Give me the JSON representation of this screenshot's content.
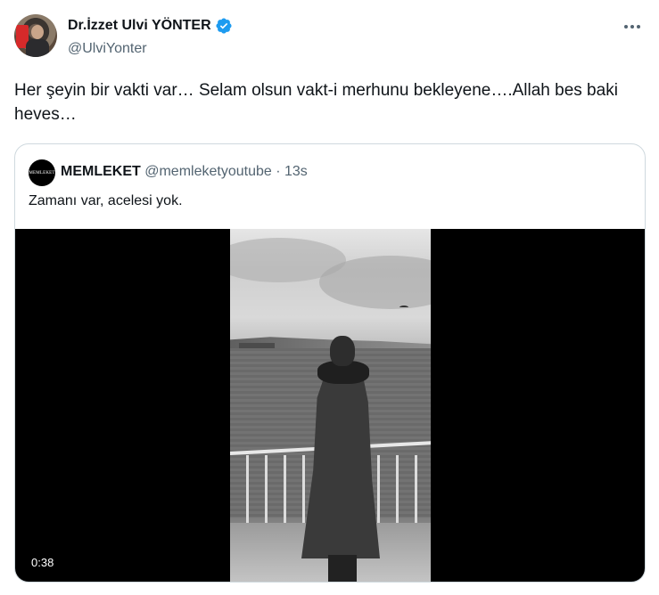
{
  "author": {
    "name": "Dr.İzzet Ulvi YÖNTER",
    "handle": "@UlviYonter",
    "verified": true
  },
  "tweet": {
    "text": "Her şeyin bir vakti var… Selam olsun vakt-i merhunu bekleyene….Allah bes baki heves…"
  },
  "quote": {
    "avatar_text": "MEMLEKET",
    "name": "MEMLEKET",
    "meta": "@memleketyoutube · 13s",
    "text": "Zamanı var, acelesi yok.",
    "video_duration": "0:38"
  },
  "icons": {
    "verified": "verified-badge-icon",
    "more": "more-options-icon"
  },
  "colors": {
    "verified_blue": "#1d9bf0",
    "secondary_text": "#536471",
    "border": "#cfd9de"
  }
}
